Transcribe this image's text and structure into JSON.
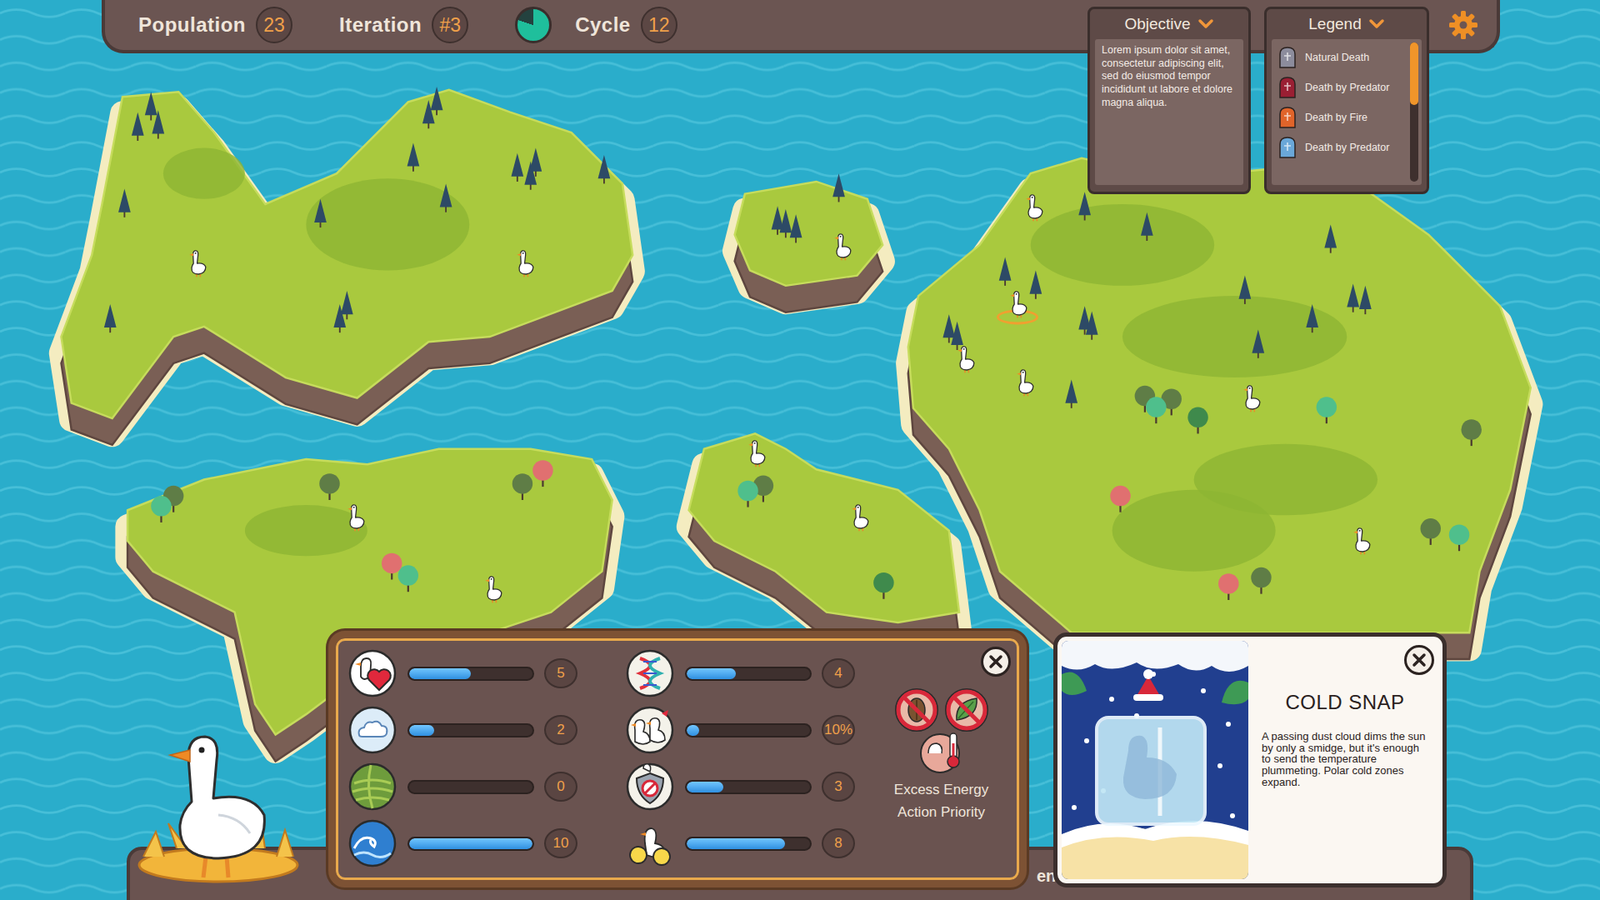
{
  "top_bar": {
    "stats": [
      {
        "label": "Population",
        "value": "23"
      },
      {
        "label": "Iteration",
        "value": "#3"
      }
    ],
    "cycle": {
      "label": "Cycle",
      "value": "12",
      "level": 0.8
    }
  },
  "objective": {
    "title": "Objective",
    "text": "Lorem ipsum dolor sit amet, consectetur adipiscing elit, sed do eiusmod tempor incididunt ut labore et dolore magna aliqua."
  },
  "legend": {
    "title": "Legend",
    "items": [
      {
        "label": "Natural Death",
        "color": "#8c8c9c"
      },
      {
        "label": "Death by Predator",
        "color": "#9a1f33"
      },
      {
        "label": "Death by Fire",
        "color": "#e0642a"
      },
      {
        "label": "Death by Predator",
        "color": "#6aa7d8"
      }
    ],
    "scrollbar": {
      "level": 0.45
    }
  },
  "geese": [
    {
      "selected": false
    },
    {
      "selected": false
    },
    {
      "selected": false
    },
    {
      "selected": false
    },
    {
      "selected": true
    },
    {
      "selected": false
    },
    {
      "selected": false
    },
    {
      "selected": false
    },
    {
      "selected": false
    },
    {
      "selected": false
    },
    {
      "selected": false
    },
    {
      "selected": false
    },
    {
      "selected": false
    }
  ],
  "stats_panel": {
    "traits": [
      {
        "kind": "heart",
        "value": "5",
        "level": 0.5
      },
      {
        "kind": "cloud",
        "value": "2",
        "level": 0.2
      },
      {
        "kind": "field",
        "value": "0",
        "level": 0
      },
      {
        "kind": "wave",
        "value": "10",
        "level": 1
      },
      {
        "kind": "dna",
        "value": "4",
        "level": 0.4
      },
      {
        "kind": "flock",
        "value": "10%",
        "level": 0.1
      },
      {
        "kind": "shield",
        "value": "3",
        "level": 0.3
      },
      {
        "kind": "chicks",
        "value": "8",
        "level": 0.8
      }
    ],
    "diet": [
      {
        "kind": "seed",
        "blocked": true
      },
      {
        "kind": "leaf",
        "blocked": true
      }
    ],
    "priority": {
      "lines": [
        "Excess Energy",
        "Action Priority"
      ]
    }
  },
  "bottom_bar": {
    "label": "en"
  },
  "event": {
    "title": "COLD SNAP",
    "text": "A passing dust cloud dims the sun by only a smidge, but it's enough to send the temperature plummeting. Polar cold zones expand."
  }
}
